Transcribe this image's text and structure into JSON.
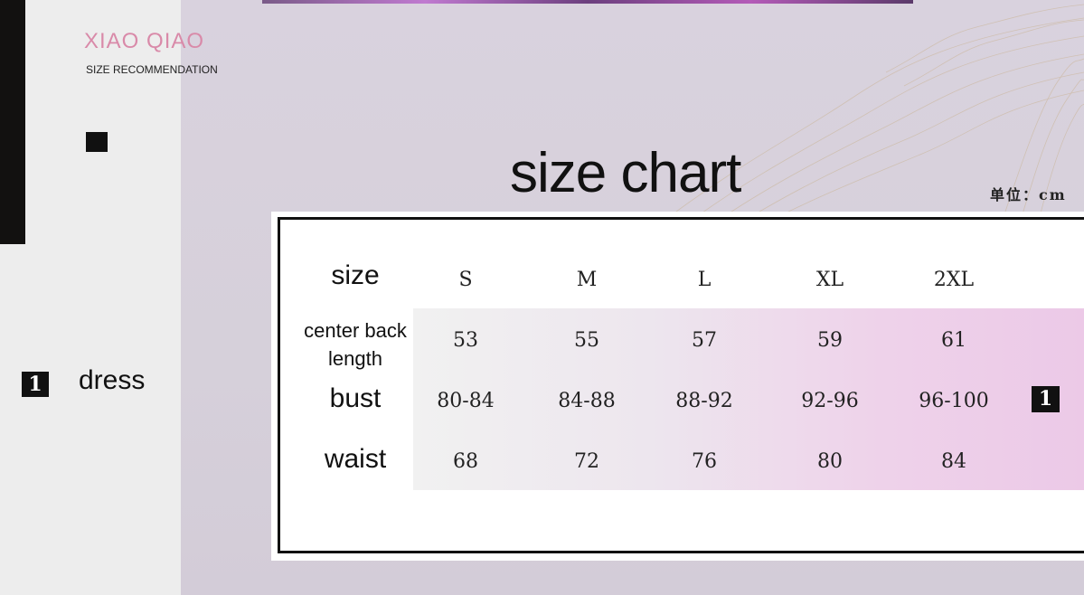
{
  "brand": {
    "name": "XIAO QIAO",
    "subtitle": "SIZE RECOMMENDATION"
  },
  "left_panel": {
    "badge": "1",
    "label": "dress"
  },
  "title": "size chart",
  "unit": "单位：cm",
  "table": {
    "header_label": "size",
    "sizes": [
      "S",
      "M",
      "L",
      "XL",
      "2XL"
    ],
    "rows": [
      {
        "label": "center back length",
        "values": [
          "53",
          "55",
          "57",
          "59",
          "61"
        ]
      },
      {
        "label": "bust",
        "values": [
          "80-84",
          "84-88",
          "88-92",
          "92-96",
          "96-100"
        ]
      },
      {
        "label": "waist",
        "values": [
          "68",
          "72",
          "76",
          "80",
          "84"
        ]
      }
    ]
  },
  "right_badge": "1",
  "colors": {
    "brand": "#d98aa9",
    "band_end": "#ecc9e7",
    "background": "#d9d2de"
  }
}
